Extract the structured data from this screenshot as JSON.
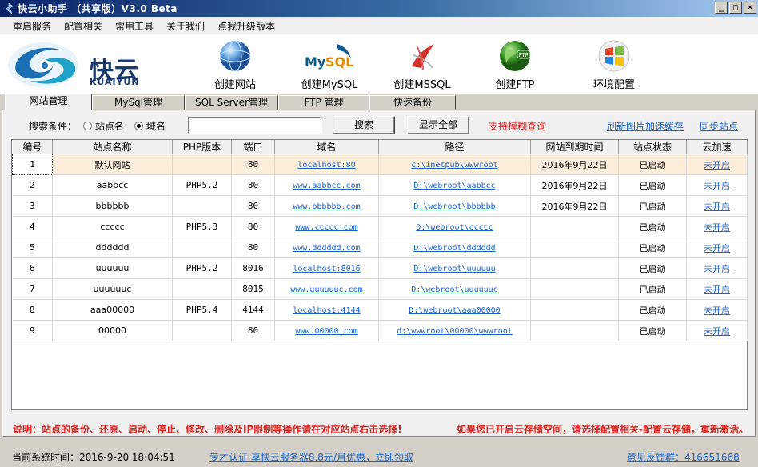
{
  "window": {
    "title": "快云小助手 （共享版）V3.0 Beta",
    "controls": [
      "_",
      "□",
      "×"
    ]
  },
  "menu": [
    "重启服务",
    "配置相关",
    "常用工具",
    "关于我们",
    "点我升级版本"
  ],
  "logo": {
    "name": "快云",
    "sub": "KUAIYUN"
  },
  "tools": [
    {
      "label": "创建网站",
      "icon": "globe-icon"
    },
    {
      "label": "创建MySQL",
      "icon": "mysql-icon"
    },
    {
      "label": "创建MSSQL",
      "icon": "mssql-icon"
    },
    {
      "label": "创建FTP",
      "icon": "ftp-icon"
    },
    {
      "label": "环境配置",
      "icon": "windows-icon"
    }
  ],
  "tabs": [
    "网站管理",
    "MySql管理",
    "SQL Server管理",
    "FTP 管理",
    "快速备份"
  ],
  "search": {
    "label": "搜索条件：",
    "radio_site": "站点名",
    "radio_domain": "域名",
    "selected": "域名",
    "input_value": "",
    "search_btn": "搜索",
    "show_all_btn": "显示全部",
    "hint": "支持模糊查询",
    "refresh_link": "刷新图片加速缓存",
    "sync_link": "同步站点"
  },
  "table": {
    "headers": [
      "编号",
      "站点名称",
      "PHP版本",
      "端口",
      "域名",
      "路径",
      "网站到期时间",
      "站点状态",
      "云加速"
    ],
    "rows": [
      [
        "1",
        "默认网站",
        "",
        "80",
        "localhost:80",
        "c:\\inetpub\\wwwroot",
        "2016年9月22日",
        "已启动",
        "未开启"
      ],
      [
        "2",
        "aabbcc",
        "PHP5.2",
        "80",
        "www.aabbcc.com",
        "D:\\webroot\\aabbcc",
        "2016年9月22日",
        "已启动",
        "未开启"
      ],
      [
        "3",
        "bbbbbb",
        "",
        "80",
        "www.bbbbbb.com",
        "D:\\webroot\\bbbbbb",
        "2016年9月22日",
        "已启动",
        "未开启"
      ],
      [
        "4",
        "ccccc",
        "PHP5.3",
        "80",
        "www.ccccc.com",
        "D:\\webroot\\ccccc",
        "",
        "已启动",
        "未开启"
      ],
      [
        "5",
        "dddddd",
        "",
        "80",
        "www.dddddd.com",
        "D:\\webroot\\dddddd",
        "",
        "已启动",
        "未开启"
      ],
      [
        "6",
        "uuuuuu",
        "PHP5.2",
        "8016",
        "localhost:8016",
        "D:\\webroot\\uuuuuu",
        "",
        "已启动",
        "未开启"
      ],
      [
        "7",
        "uuuuuuc",
        "",
        "8015",
        "www.uuuuuuc.com",
        "D:\\webroot\\uuuuuuc",
        "",
        "已启动",
        "未开启"
      ],
      [
        "8",
        "aaa00000",
        "PHP5.4",
        "4144",
        "localhost:4144",
        "D:\\webroot\\aaa00000",
        "",
        "已启动",
        "未开启"
      ],
      [
        "9",
        "00000",
        "",
        "80",
        "www.00000.com",
        "d:\\wwwroot\\00000\\wwwroot",
        "",
        "已启动",
        "未开启"
      ]
    ]
  },
  "notes": {
    "left": "说明：站点的备份、还原、启动、停止、修改、删除及IP限制等操作请在对应站点右击选择!",
    "right": "如果您已开启云存储空间，请选择配置相关-配置云存储，重新激活。"
  },
  "status": {
    "time": "当前系统时间：2016-9-20 18:04:51",
    "ad": "专才认证  享快云服务器8.8元/月优惠，立即领取 ",
    "feedback": "意见反馈群：416651668"
  },
  "colors": {
    "accent_red": "#e0201b",
    "link_blue": "#1a63c9",
    "title_blue": "#0a246a",
    "selected_row": "#fdeedc"
  }
}
